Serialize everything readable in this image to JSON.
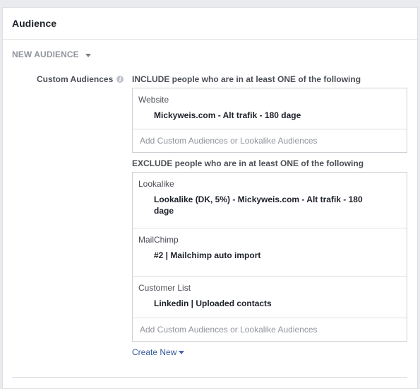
{
  "panel": {
    "title": "Audience"
  },
  "audience_selector": {
    "label": "NEW AUDIENCE"
  },
  "custom_audiences": {
    "label": "Custom Audiences",
    "include": {
      "heading": "INCLUDE people who are in at least ONE of the following",
      "groups": [
        {
          "name": "Website",
          "item": "Mickyweis.com - Alt trafik - 180 dage"
        }
      ],
      "add_placeholder": "Add Custom Audiences or Lookalike Audiences"
    },
    "exclude": {
      "heading": "EXCLUDE people who are in at least ONE of the following",
      "groups": [
        {
          "name": "Lookalike",
          "item": "Lookalike (DK, 5%) - Mickyweis.com - Alt trafik - 180 dage"
        },
        {
          "name": "MailChimp",
          "item": "#2 | Mailchimp auto import"
        },
        {
          "name": "Customer List",
          "item": "Linkedin | Uploaded contacts"
        }
      ],
      "add_placeholder": "Add Custom Audiences or Lookalike Audiences"
    },
    "create_new_label": "Create New"
  },
  "colors": {
    "link": "#365899",
    "muted_text": "#90949c",
    "border": "#ccd0d5",
    "page_background": "#e9ebee"
  },
  "icons": [
    "info-icon",
    "chevron-down-icon"
  ]
}
